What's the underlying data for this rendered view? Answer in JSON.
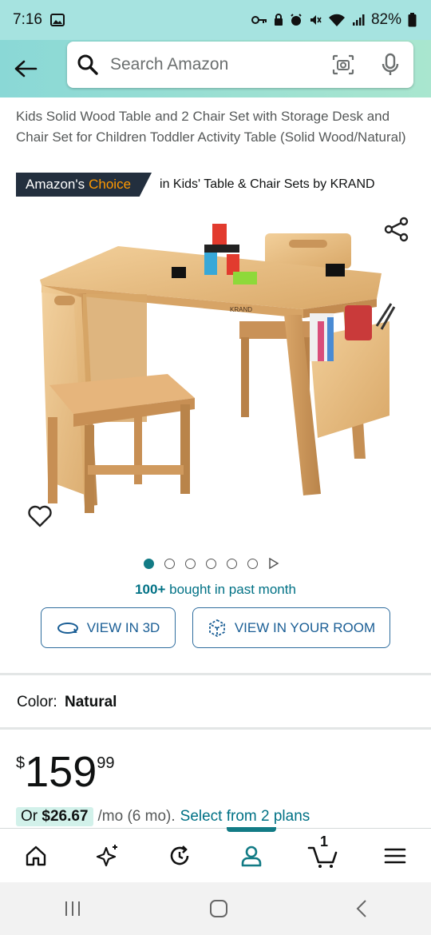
{
  "status": {
    "time": "7:16",
    "battery": "82%"
  },
  "search": {
    "placeholder": "Search Amazon"
  },
  "product": {
    "title": "Kids Solid Wood Table and 2 Chair Set with Storage Desk and Chair Set for Children Toddler Activity Table (Solid Wood/Natural)",
    "badge_prefix": "Amazon's",
    "badge_choice": "Choice",
    "badge_category": "in Kids' Table & Chair Sets by KRAND",
    "brand_mark": "KRAND",
    "image_count": 6,
    "bought_count": "100+",
    "bought_text": "bought in past month",
    "view_3d_label": "VIEW IN 3D",
    "view_room_label": "VIEW IN YOUR ROOM",
    "color_label": "Color:",
    "color_value": "Natural",
    "price_currency": "$",
    "price_whole": "159",
    "price_fraction": "99",
    "financing_prefix": "Or",
    "financing_amount": "$26.67",
    "financing_term": "/mo (6 mo).",
    "financing_link": "Select from 2 plans"
  },
  "nav": {
    "cart_count": "1",
    "active": "account"
  },
  "colors": {
    "accent": "#127b85",
    "badge_bg": "#232f3e",
    "badge_choice": "#ff9900",
    "link": "#007185"
  }
}
